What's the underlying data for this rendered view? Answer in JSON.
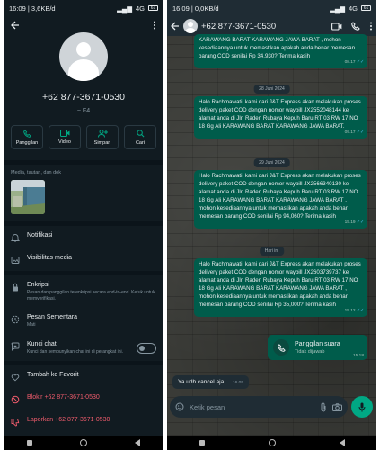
{
  "left": {
    "status": {
      "time": "16:09",
      "speed": "3,6KB/d",
      "network": "4G",
      "battery": "61"
    },
    "phone": "+62 877-3671-0530",
    "subname": "~ F4",
    "actions": [
      {
        "label": "Panggilan",
        "icon": "phone-icon"
      },
      {
        "label": "Video",
        "icon": "video-icon"
      },
      {
        "label": "Simpan",
        "icon": "add-person-icon"
      },
      {
        "label": "Cari",
        "icon": "search-icon"
      }
    ],
    "media_title": "Media, tautan, dan dok",
    "rows": {
      "notifications": "Notifikasi",
      "media_visibility": "Visibilitas media",
      "encryption_title": "Enkripsi",
      "encryption_sub": "Pesan dan panggilan terenkripsi secara end-to-end. Ketuk untuk memverifikasi.",
      "temp_title": "Pesan Sementara",
      "temp_sub": "Mati",
      "lock_title": "Kunci chat",
      "lock_sub": "Kunci dan sembunyikan chat ini di perangkat ini.",
      "favorite": "Tambah ke Favorit",
      "block": "Blokir +62 877-3671-0530",
      "report": "Laporkan +62 877-3671-0530"
    }
  },
  "right": {
    "status": {
      "time": "16:09",
      "speed": "0,0KB/d",
      "network": "4G",
      "battery": "61"
    },
    "title": "+62 877-3671-0530",
    "messages": {
      "m1_text": "KARAWANG BARAT KARAWANG JAWA BARAT , mohon kesediaannya untuk memastikan apakah anda benar memesan barang COD senilai Rp 34,930? Terima kasih",
      "m1_time": "08.17",
      "date1": "28 Juni 2024",
      "m2_text": "Halo Rachmawati, kami dari J&T Express akan melakukan proses delivery paket COD dengan nomor waybill JX2552048144 ke alamat anda di Jln Raden Rubaya Kepuh Baru RT 03 RW 17 NO 18 Gg Ali  KARAWANG BARAT KARAWANG JAWA BARAT.",
      "m2_time": "09.17",
      "date2": "29 Juni 2024",
      "m3_text": "Halo Rachmawati, kami dari J&T Express akan melakukan proses delivery paket COD dengan nomor waybill JX2566340130 ke alamat anda di Jln Raden Rubaya Kepuh Baru RT 03 RW 17 NO 18 Gg Ali KARAWANG BARAT KARAWANG JAWA BARAT , mohon kesediaannya untuk memastikan apakah anda benar memesan barang COD senilai Rp 94,060? Terima kasih",
      "m3_time": "15.19",
      "date3": "Hari ini",
      "m4_text": "Halo Rachmawati, kami dari J&T Express akan melakukan proses delivery paket COD dengan nomor waybill JX2603739737 ke alamat anda di Jln Raden Rubaya Kepuh Baru RT 03 RW 17 NO 18 Gg Ali KARAWANG BARAT KARAWANG JAWA BARAT , mohon kesediaannya untuk memastikan apakah anda benar memesan barang COD senilai Rp 35,000? Terima kasih",
      "m4_time": "15.12",
      "call_title": "Panggilan suara",
      "call_sub": "Tidak dijawab",
      "call_time": "15.18",
      "in_text": "Ya udh cancel aja",
      "in_time": "16.05"
    },
    "composer_placeholder": "Ketik pesan"
  },
  "colors": {
    "bg": "#111b21",
    "bubble_out": "#005c4b",
    "accent": "#00a884",
    "danger": "#f15c6d",
    "read_tick": "#53bdeb"
  }
}
